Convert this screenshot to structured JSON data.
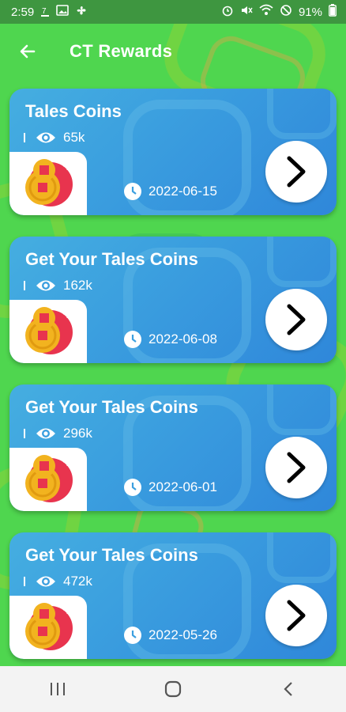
{
  "status_bar": {
    "time": "2:59",
    "battery": "91%",
    "icons_left": [
      "notification-7-icon",
      "image-icon",
      "fan-icon"
    ],
    "icons_right": [
      "alarm-icon",
      "mute-icon",
      "wifi-icon",
      "dnd-icon",
      "battery-icon"
    ]
  },
  "app_bar": {
    "title": "CT Rewards",
    "back_icon": "arrow-left-icon"
  },
  "colors": {
    "background": "#4fd64f",
    "status_bar": "#3e9640",
    "card": "#3b9fdf",
    "coin": "#f2b31f",
    "coin_back": "#e8344e"
  },
  "cards": [
    {
      "title": "Tales Coins",
      "views": "65k",
      "date": "2022-06-15"
    },
    {
      "title": "Get Your Tales Coins",
      "views": "162k",
      "date": "2022-06-08"
    },
    {
      "title": "Get Your Tales Coins",
      "views": "296k",
      "date": "2022-06-01"
    },
    {
      "title": "Get Your Tales Coins",
      "views": "472k",
      "date": "2022-05-26"
    }
  ],
  "nav_bar": {
    "recents_icon": "recents-icon",
    "home_icon": "home-icon",
    "back_icon": "back-icon"
  }
}
